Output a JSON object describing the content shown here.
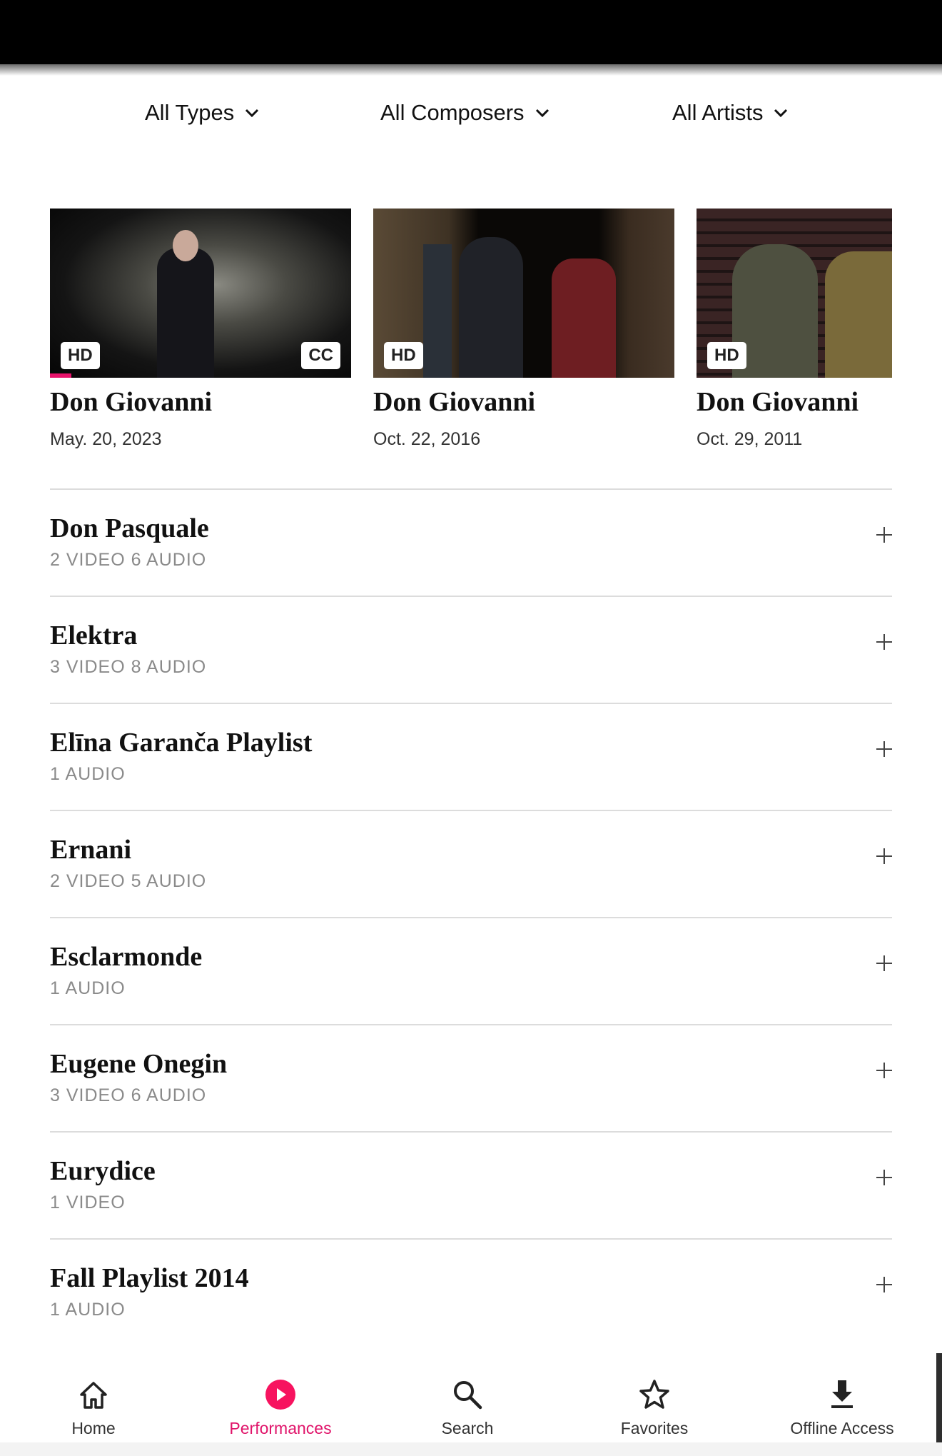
{
  "filters": [
    {
      "label": "All Types"
    },
    {
      "label": "All Composers"
    },
    {
      "label": "All Artists"
    }
  ],
  "featured": [
    {
      "title": "Don Giovanni",
      "date": "May. 20, 2023",
      "badges": [
        "HD",
        "CC"
      ],
      "progress_percent": 7
    },
    {
      "title": "Don Giovanni",
      "date": "Oct. 22, 2016",
      "badges": [
        "HD"
      ]
    },
    {
      "title": "Don Giovanni",
      "date": "Oct. 29, 2011",
      "badges": [
        "HD"
      ]
    }
  ],
  "list": [
    {
      "title": "Don Pasquale",
      "sub": "2  VIDEO 6 AUDIO"
    },
    {
      "title": "Elektra",
      "sub": "3  VIDEO 8 AUDIO"
    },
    {
      "title": "Elīna Garanča Playlist",
      "sub": "1 AUDIO"
    },
    {
      "title": "Ernani",
      "sub": "2  VIDEO 5 AUDIO"
    },
    {
      "title": "Esclarmonde",
      "sub": "1 AUDIO"
    },
    {
      "title": "Eugene Onegin",
      "sub": "3  VIDEO 6 AUDIO"
    },
    {
      "title": "Eurydice",
      "sub": "1  VIDEO"
    },
    {
      "title": "Fall Playlist 2014",
      "sub": "1 AUDIO"
    }
  ],
  "nav": [
    {
      "label": "Home",
      "icon": "home-icon"
    },
    {
      "label": "Performances",
      "icon": "play-circle-icon",
      "active": true
    },
    {
      "label": "Search",
      "icon": "search-icon"
    },
    {
      "label": "Favorites",
      "icon": "star-icon"
    },
    {
      "label": "Offline Access",
      "icon": "download-icon"
    }
  ],
  "colors": {
    "accent": "#e8136b",
    "divider": "#dcdcdc",
    "subtext": "#8a8a8a"
  }
}
